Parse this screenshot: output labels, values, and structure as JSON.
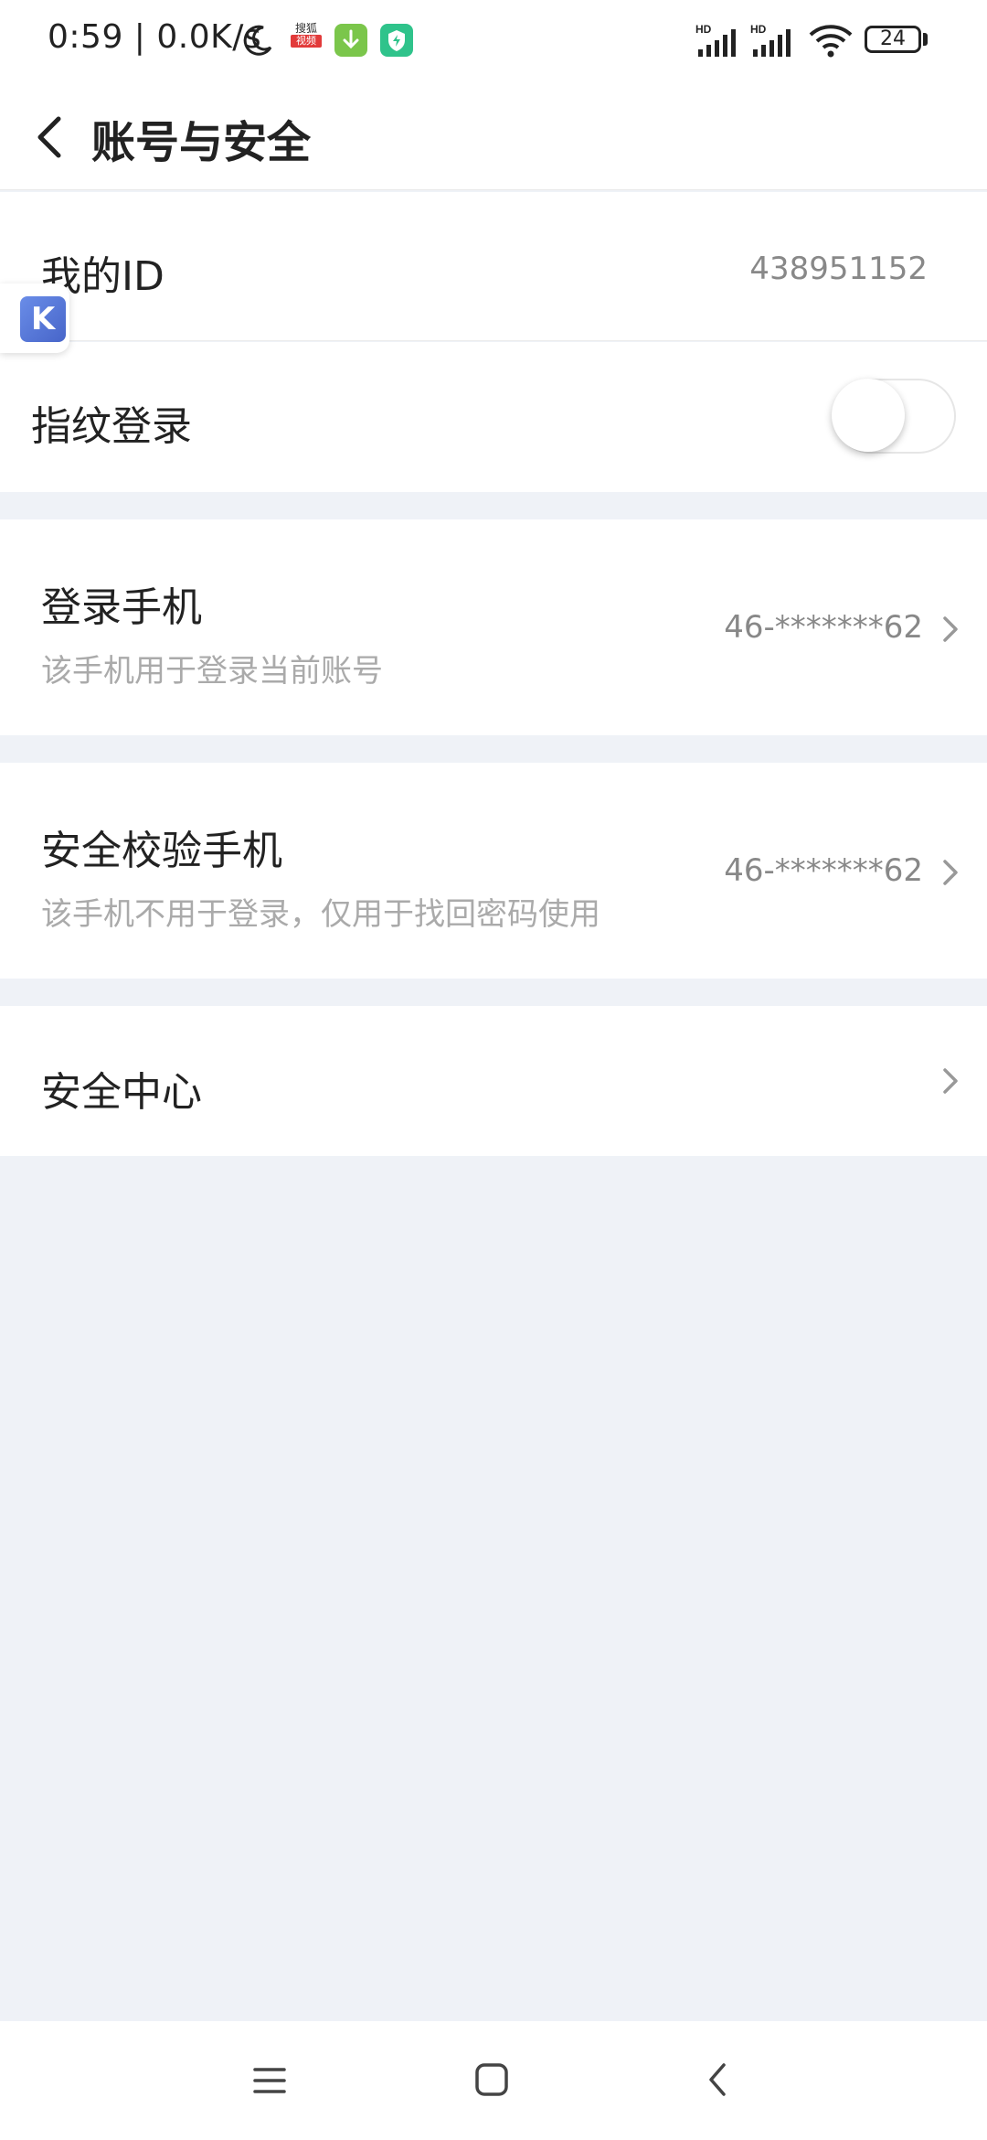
{
  "status_bar": {
    "time_speed": "0:59 | 0.0K/s",
    "sohu_top": "搜狐",
    "sohu_bottom": "视频",
    "signal_label": "HD",
    "battery": "24"
  },
  "header": {
    "title": "账号与安全"
  },
  "rows": {
    "my_id": {
      "label": "我的ID",
      "value": "438951152"
    },
    "fingerprint": {
      "label": "指纹登录",
      "enabled": false
    },
    "login_phone": {
      "label": "登录手机",
      "subtitle": "该手机用于登录当前账号",
      "value": "46-*******62"
    },
    "security_phone": {
      "label": "安全校验手机",
      "subtitle": "该手机不用于登录，仅用于找回密码使用",
      "value": "46-*******62"
    },
    "security_center": {
      "label": "安全中心"
    }
  },
  "float_badge": {
    "letter": "K"
  },
  "colors": {
    "background": "#eff2f7",
    "card": "#ffffff",
    "primary_text": "#222222",
    "secondary_text": "#aaaaaa",
    "value_text": "#888888"
  }
}
